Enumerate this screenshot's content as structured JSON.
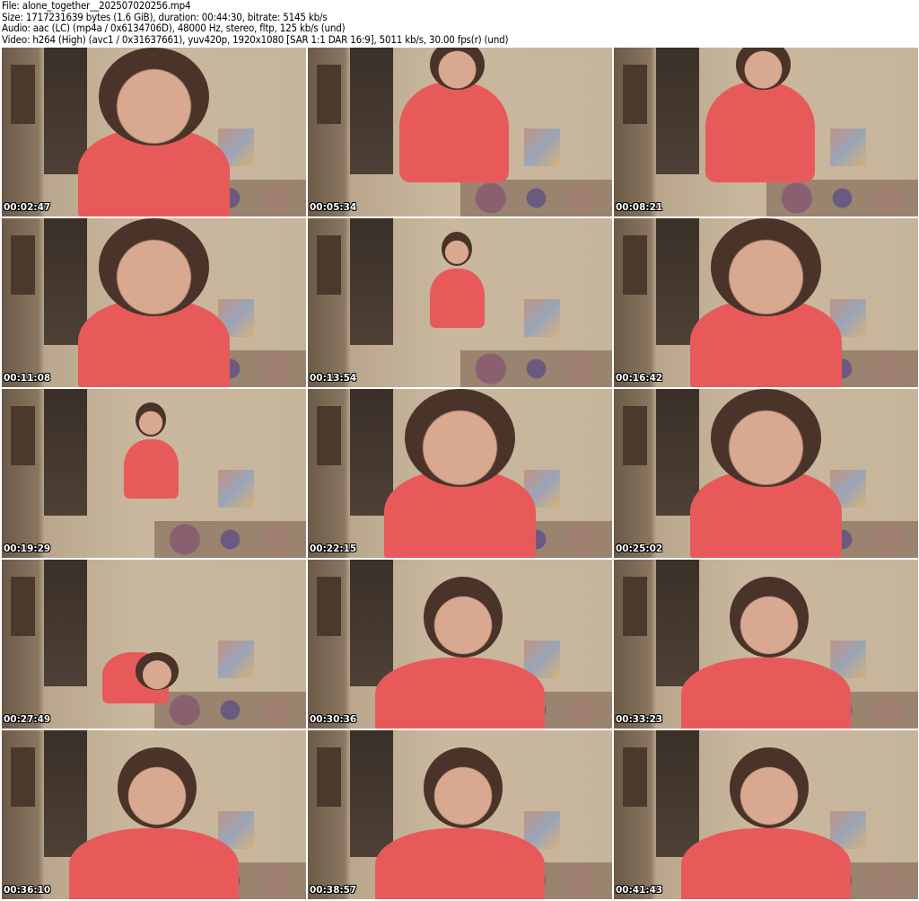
{
  "header": {
    "file": "File: alone_together__202507020256.mp4",
    "size": "Size: 1717231639 bytes (1.6 GiB), duration: 00:44:30, bitrate: 5145 kb/s",
    "audio": "Audio: aac (LC) (mp4a / 0x6134706D), 48000 Hz, stereo, fltp, 125 kb/s (und)",
    "video": "Video: h264 (High) (avc1 / 0x31637661), yuv420p, 1920x1080 [SAR 1:1 DAR 16:9], 5011 kb/s, 30.00 fps(r) (und)"
  },
  "thumbnails": [
    {
      "timestamp": "00:02:47",
      "pose": "close"
    },
    {
      "timestamp": "00:05:34",
      "pose": "standing"
    },
    {
      "timestamp": "00:08:21",
      "pose": "standing"
    },
    {
      "timestamp": "00:11:08",
      "pose": "close"
    },
    {
      "timestamp": "00:13:54",
      "pose": "far"
    },
    {
      "timestamp": "00:16:42",
      "pose": "close"
    },
    {
      "timestamp": "00:19:29",
      "pose": "far"
    },
    {
      "timestamp": "00:22:15",
      "pose": "close"
    },
    {
      "timestamp": "00:25:02",
      "pose": "close"
    },
    {
      "timestamp": "00:27:49",
      "pose": "low"
    },
    {
      "timestamp": "00:30:36",
      "pose": "seated"
    },
    {
      "timestamp": "00:33:23",
      "pose": "seated"
    },
    {
      "timestamp": "00:36:10",
      "pose": "seated"
    },
    {
      "timestamp": "00:38:57",
      "pose": "seated"
    },
    {
      "timestamp": "00:41:43",
      "pose": "seated"
    }
  ]
}
